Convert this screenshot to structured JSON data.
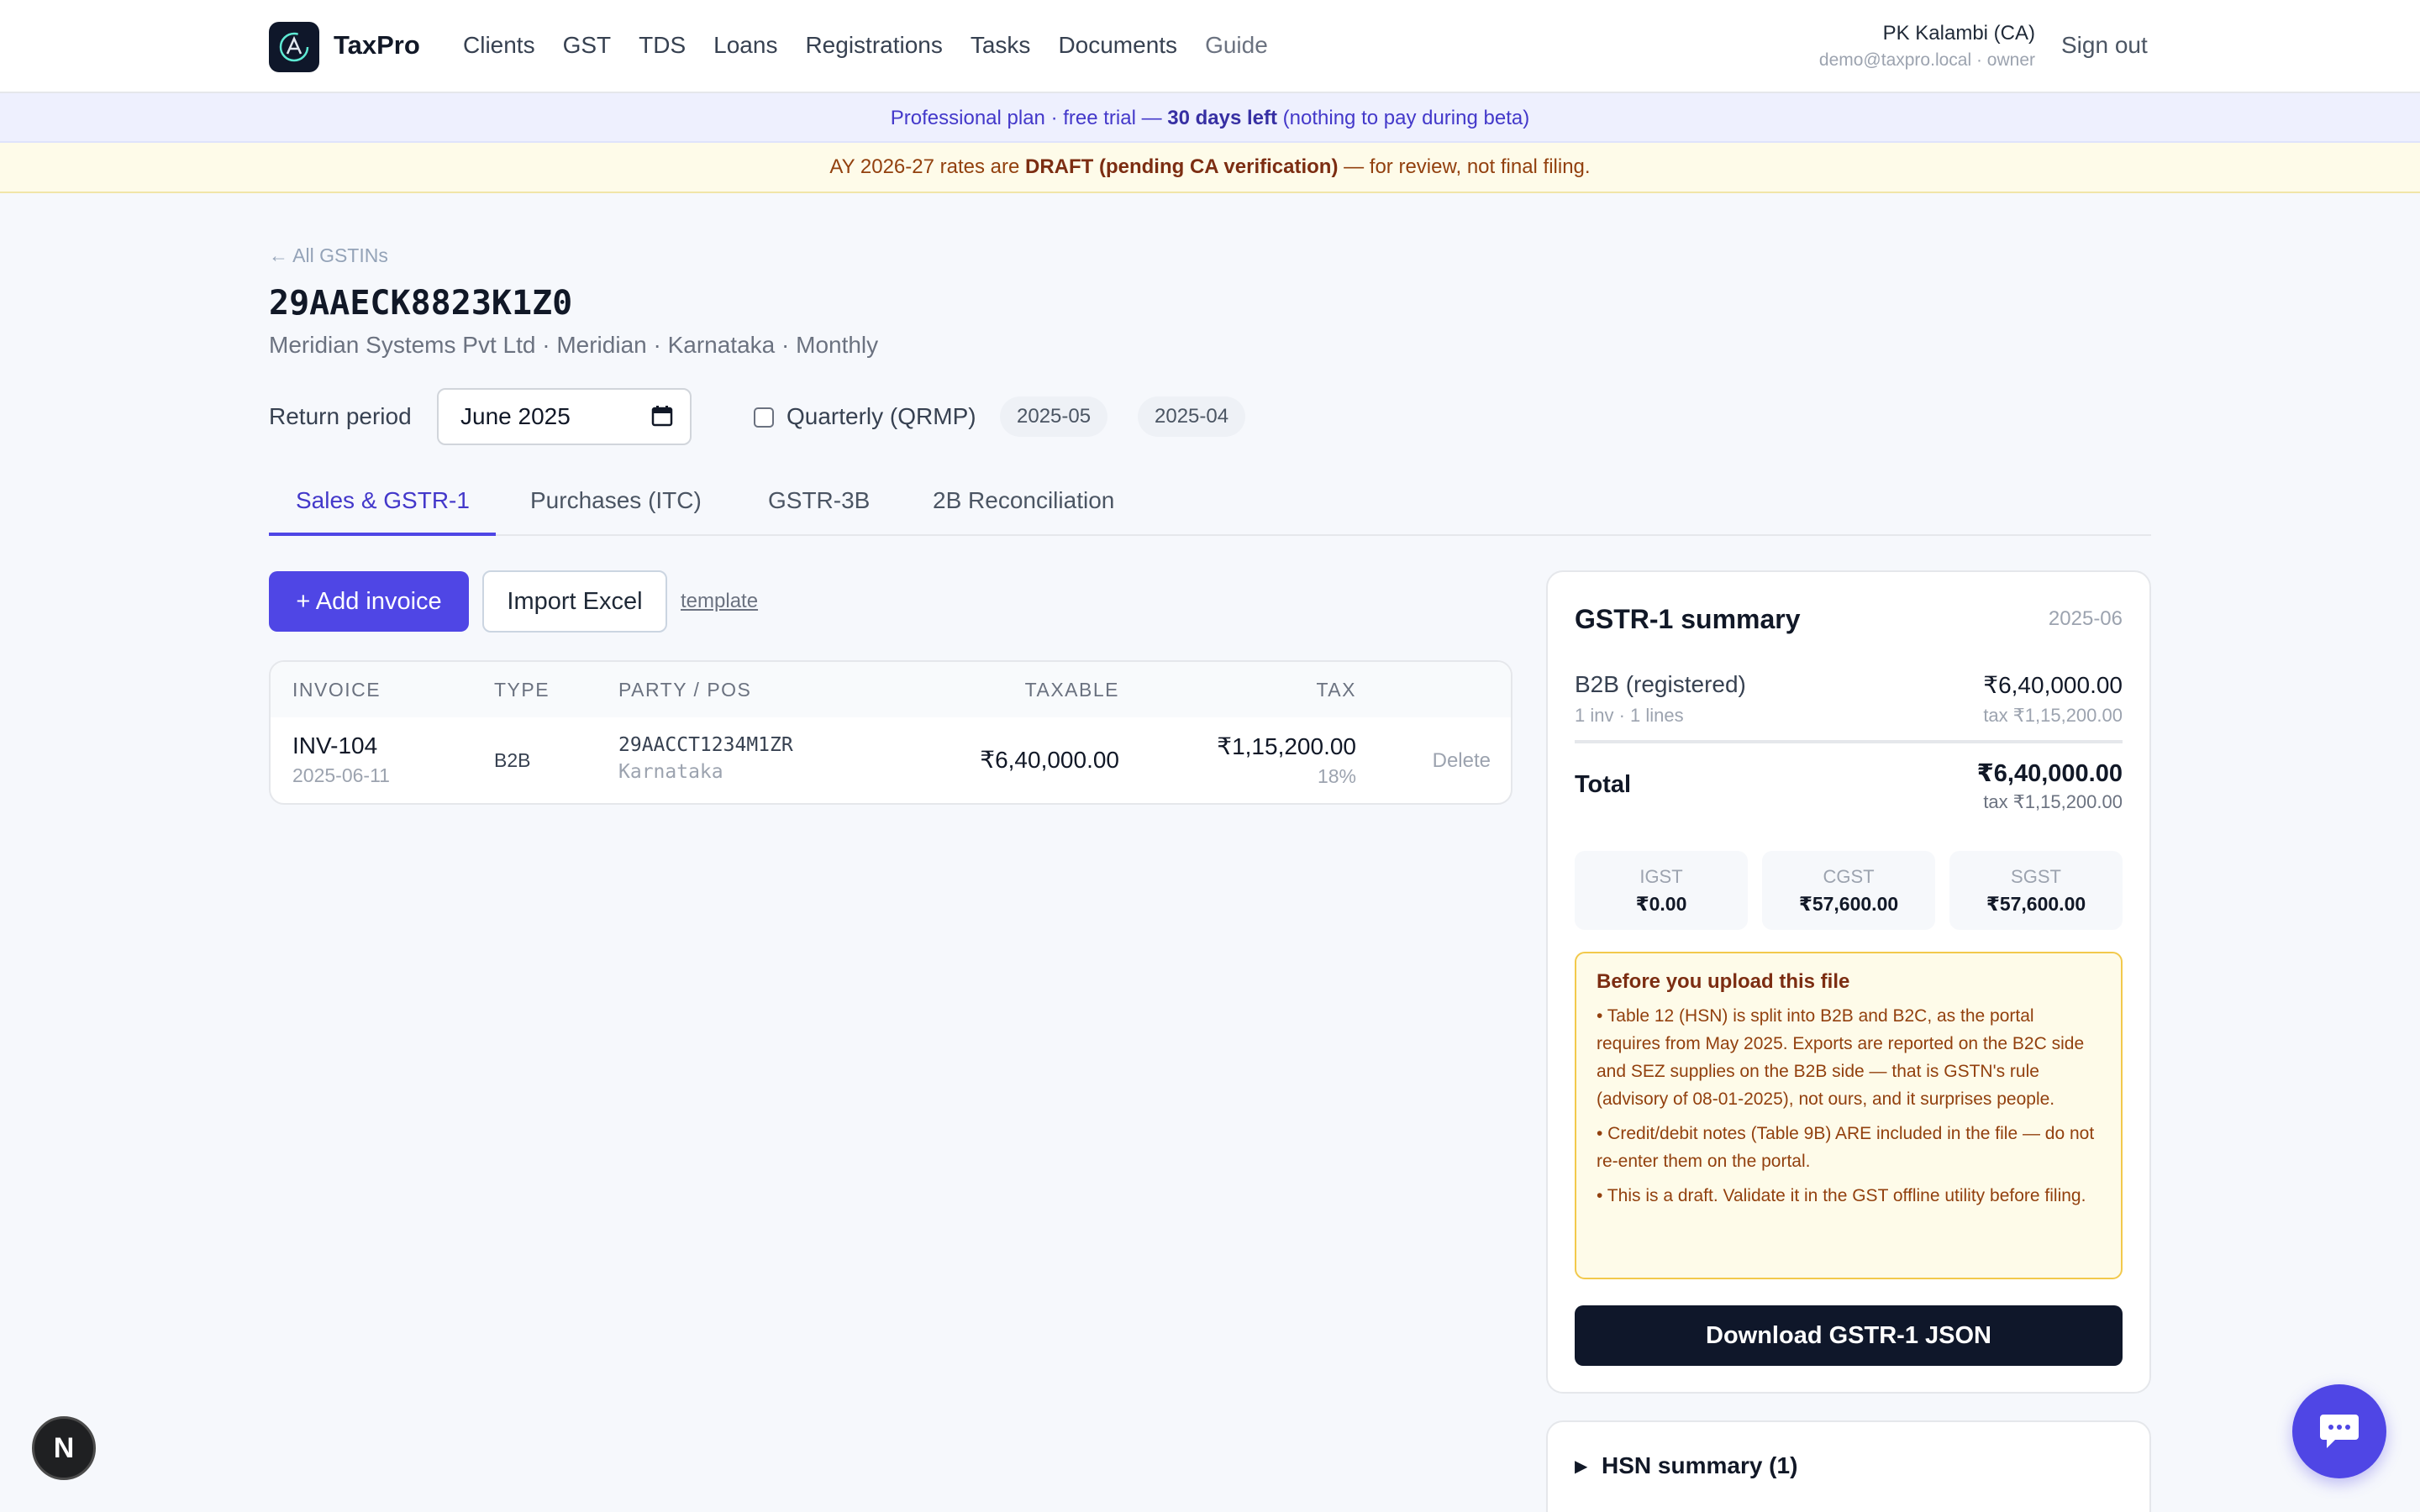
{
  "header": {
    "brand": "TaxPro",
    "nav": [
      "Clients",
      "GST",
      "TDS",
      "Loans",
      "Registrations",
      "Tasks",
      "Documents",
      "Guide"
    ],
    "user_name": "PK Kalambi (CA)",
    "user_email": "demo@taxpro.local · owner",
    "sign_out": "Sign out"
  },
  "banners": {
    "plan_prefix": "Professional plan · free trial — ",
    "plan_days": "30 days left",
    "plan_suffix": " (nothing to pay during beta)",
    "draft_prefix": "AY 2026-27 rates are ",
    "draft_bold": "DRAFT (pending CA verification)",
    "draft_suffix": " — for review, not final filing."
  },
  "page": {
    "back_link": "← All GSTINs",
    "gstin": "29AAECK8823K1Z0",
    "subtitle": "Meridian Systems Pvt Ltd · Meridian · Karnataka · Monthly",
    "period_label": "Return period",
    "period_value": "June 2025",
    "qrmp_label": "Quarterly (QRMP)",
    "qrmp_checked": false,
    "period_chips": [
      "2025-05",
      "2025-04"
    ]
  },
  "tabs": {
    "items": [
      "Sales & GSTR-1",
      "Purchases (ITC)",
      "GSTR-3B",
      "2B Reconciliation"
    ],
    "active": "Sales & GSTR-1"
  },
  "actions": {
    "add_invoice": "+ Add invoice",
    "import_excel": "Import Excel",
    "template": "template"
  },
  "invoice_table": {
    "columns": [
      "INVOICE",
      "TYPE",
      "PARTY / POS",
      "TAXABLE",
      "TAX"
    ],
    "rows": [
      {
        "invoice": "INV-104",
        "date": "2025-06-11",
        "type": "B2B",
        "party": "29AACCT1234M1ZR",
        "pos": "Karnataka",
        "taxable": "₹6,40,000.00",
        "tax": "₹1,15,200.00",
        "rate": "18%",
        "action": "Delete"
      }
    ]
  },
  "summary": {
    "title": "GSTR-1 summary",
    "period": "2025-06",
    "b2b_label": "B2B (registered)",
    "b2b_sub": "1 inv · 1 lines",
    "b2b_value": "₹6,40,000.00",
    "b2b_tax": "tax ₹1,15,200.00",
    "total_label": "Total",
    "total_value": "₹6,40,000.00",
    "total_tax": "tax ₹1,15,200.00",
    "tiles": [
      {
        "label": "IGST",
        "value": "₹0.00"
      },
      {
        "label": "CGST",
        "value": "₹57,600.00"
      },
      {
        "label": "SGST",
        "value": "₹57,600.00"
      }
    ],
    "notice_title": "Before you upload this file",
    "notice_items": [
      "• Table 12 (HSN) is split into B2B and B2C, as the portal requires from May 2025. Exports are reported on the B2C side and SEZ supplies on the B2B side — that is GSTN's rule (advisory of 08-01-2025), not ours, and it surprises people.",
      "• Credit/debit notes (Table 9B) ARE included in the file — do not re-enter them on the portal.",
      "• This is a draft. Validate it in the GST offline utility before filing."
    ],
    "download": "Download GSTR-1 JSON"
  },
  "hsn": {
    "label": "HSN summary (1)",
    "expanded": false
  },
  "floating": {
    "next_badge": "N",
    "chat_icon": "chat-bubble-icon"
  },
  "colors": {
    "accent": "#4f46e5",
    "dark": "#0f172a",
    "warning_bg": "#fefbe9",
    "warning_border": "#f2c94c",
    "plan_banner_bg": "#eef0fe"
  }
}
